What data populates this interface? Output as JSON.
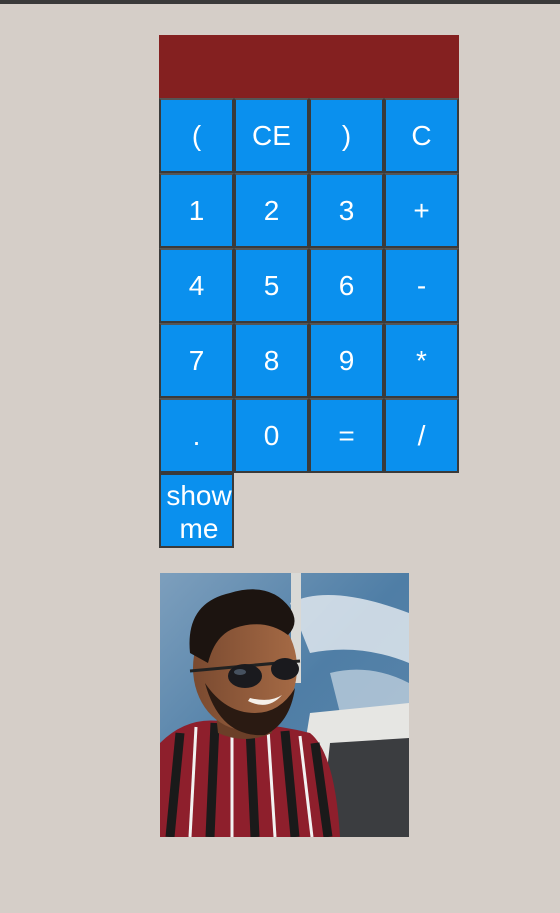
{
  "calculator": {
    "display_value": "",
    "keys": [
      "(",
      "CE",
      ")",
      "C",
      "1",
      "2",
      "3",
      "+",
      "4",
      "5",
      "6",
      "-",
      "7",
      "8",
      "9",
      "*",
      ".",
      "0",
      "=",
      "/"
    ],
    "show_button_label": "show me"
  },
  "colors": {
    "page_background": "#d5cec8",
    "display_background": "#842020",
    "key_background": "#0a90ee",
    "key_text": "#ffffff",
    "key_border": "#3a3a3a"
  },
  "photo": {
    "subject": "smiling man wearing sunglasses and a red striped shirt on a boat"
  }
}
